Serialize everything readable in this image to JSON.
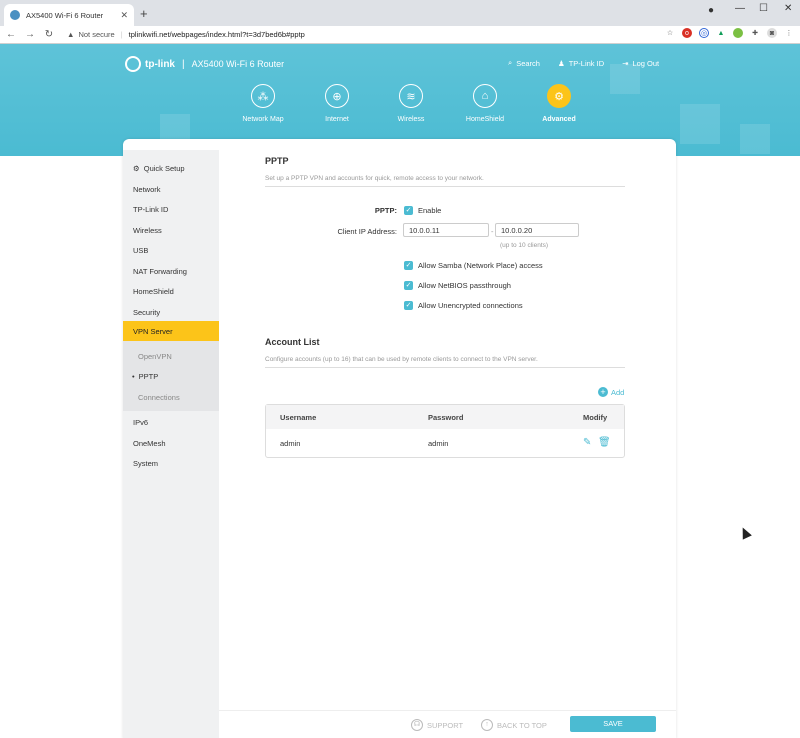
{
  "browser": {
    "tab_title": "AX5400 Wi-Fi 6 Router",
    "not_secure": "Not secure",
    "url": "tplinkwifi.net/webpages/index.html?t=3d7bed6b#pptp"
  },
  "header": {
    "brand": "tp-link",
    "divider": "|",
    "model": "AX5400 Wi-Fi 6 Router",
    "links": [
      "Search",
      "TP-Link ID",
      "Log Out"
    ],
    "nav": [
      "Network Map",
      "Internet",
      "Wireless",
      "HomeShield",
      "Advanced"
    ],
    "active_nav": "Advanced"
  },
  "sidebar": {
    "quick_setup": "Quick Setup",
    "items": [
      "Network",
      "TP-Link ID",
      "Wireless",
      "USB",
      "NAT Forwarding",
      "HomeShield",
      "Security",
      "VPN Server"
    ],
    "sub_items": [
      "OpenVPN",
      "PPTP",
      "Connections"
    ],
    "items_after": [
      "IPv6",
      "OneMesh",
      "System"
    ],
    "active_item": "VPN Server",
    "active_sub": "PPTP"
  },
  "pptp": {
    "title": "PPTP",
    "description": "Set up a PPTP VPN and accounts for quick, remote access to your network.",
    "pptp_label": "PPTP:",
    "enable_label": "Enable",
    "client_ip_label": "Client IP Address:",
    "ip_start": "10.0.0.11",
    "ip_dash": "-",
    "ip_end": "10.0.0.20",
    "ip_hint": "(up to 10 clients)",
    "options": [
      "Allow Samba (Network Place) access",
      "Allow NetBIOS passthrough",
      "Allow Unencrypted connections"
    ]
  },
  "accounts": {
    "title": "Account List",
    "description": "Configure accounts (up to 16) that can be used by remote clients to connect to the VPN server.",
    "add_label": "Add",
    "columns": [
      "Username",
      "Password",
      "Modify"
    ],
    "rows": [
      {
        "username": "admin",
        "password": "admin"
      }
    ]
  },
  "footer": {
    "support": "SUPPORT",
    "back_to_top": "BACK TO TOP",
    "save": "SAVE"
  },
  "colors": {
    "header": "#4bbbd2",
    "accent": "#fcc419"
  }
}
